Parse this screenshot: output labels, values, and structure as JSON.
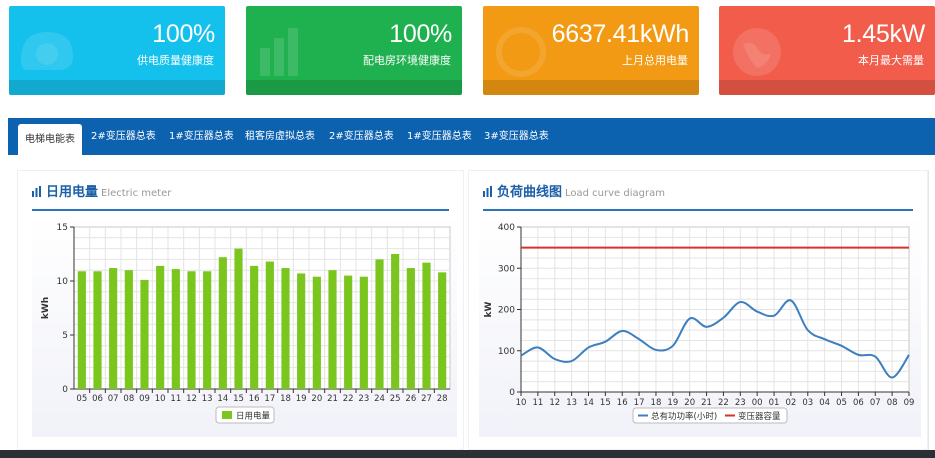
{
  "stat_cards": [
    {
      "value": "100%",
      "label": "供电质量健康度",
      "color": "#14c1ec",
      "icon": "wave-icon"
    },
    {
      "value": "100%",
      "label": "配电房环境健康度",
      "color": "#1fb050",
      "icon": "bar-chart-icon"
    },
    {
      "value": "6637.41kWh",
      "label": "上月总用电量",
      "color": "#f29a13",
      "icon": "meter-icon"
    },
    {
      "value": "1.45kW",
      "label": "本月最大需量",
      "color": "#f15c4b",
      "icon": "globe-icon"
    }
  ],
  "tabs": [
    {
      "label": "电梯电能表",
      "active": true
    },
    {
      "label": "2#变压器总表",
      "active": false
    },
    {
      "label": "1#变压器总表",
      "active": false
    },
    {
      "label": "租客房虚拟总表",
      "active": false
    },
    {
      "label": "2#变压器总表",
      "active": false
    },
    {
      "label": "1#变压器总表",
      "active": false
    },
    {
      "label": "3#变压器总表",
      "active": false
    }
  ],
  "panels": {
    "daily": {
      "title": "日用电量",
      "subtitle": "Electric meter"
    },
    "load": {
      "title": "负荷曲线图",
      "subtitle": "Load curve diagram"
    }
  },
  "chart_data": [
    {
      "type": "bar",
      "categories": [
        "05",
        "06",
        "07",
        "08",
        "09",
        "10",
        "11",
        "12",
        "13",
        "14",
        "15",
        "16",
        "17",
        "18",
        "19",
        "20",
        "21",
        "22",
        "23",
        "24",
        "25",
        "26",
        "27",
        "28"
      ],
      "series": [
        {
          "name": "日用电量",
          "values": [
            10.9,
            10.9,
            11.2,
            11.0,
            10.1,
            11.4,
            11.1,
            10.9,
            10.9,
            12.2,
            13.0,
            11.4,
            11.8,
            11.2,
            10.7,
            10.4,
            11.0,
            10.5,
            10.4,
            12.0,
            12.5,
            11.2,
            11.7,
            10.8
          ],
          "color": "#7ac51e"
        }
      ],
      "ylabel": "kWh",
      "ylim": [
        0,
        15
      ],
      "yticks": [
        "0",
        "5",
        "10",
        "15"
      ],
      "grid": true,
      "legend": "bottom"
    },
    {
      "type": "line",
      "categories": [
        "10",
        "11",
        "12",
        "13",
        "14",
        "15",
        "16",
        "17",
        "18",
        "19",
        "20",
        "21",
        "22",
        "23",
        "00",
        "01",
        "02",
        "03",
        "04",
        "05",
        "06",
        "07",
        "08",
        "09"
      ],
      "series": [
        {
          "name": "总有功功率(小时)",
          "color": "#3d7fbf",
          "values": [
            88,
            108,
            80,
            75,
            108,
            122,
            148,
            128,
            102,
            112,
            178,
            158,
            180,
            218,
            195,
            185,
            222,
            150,
            128,
            112,
            90,
            86,
            35,
            90
          ]
        },
        {
          "name": "变压器容量",
          "color": "#d9322b",
          "values": [
            350,
            350,
            350,
            350,
            350,
            350,
            350,
            350,
            350,
            350,
            350,
            350,
            350,
            350,
            350,
            350,
            350,
            350,
            350,
            350,
            350,
            350,
            350,
            350
          ]
        }
      ],
      "ylabel": "kW",
      "ylim": [
        0,
        400
      ],
      "yticks": [
        "0",
        "100",
        "200",
        "300",
        "400"
      ],
      "grid": true,
      "legend": "bottom"
    }
  ]
}
